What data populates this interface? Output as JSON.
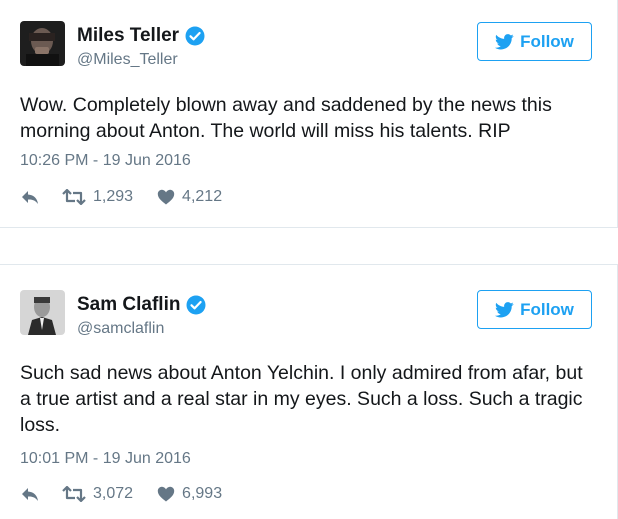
{
  "colors": {
    "accent": "#1da1f2",
    "text": "#14171a",
    "muted": "#657786",
    "divider": "#e1e8ed"
  },
  "tweets": [
    {
      "name": "Miles Teller",
      "handle": "@Miles_Teller",
      "follow_label": "Follow",
      "text": "Wow. Completely blown away and saddened by the news this morning about Anton. The world will miss his talents. RIP",
      "timestamp": "10:26 PM - 19 Jun 2016",
      "retweets": "1,293",
      "likes": "4,212",
      "icons": {
        "verified": "verified-badge-icon",
        "follow": "twitter-bird-icon",
        "reply": "reply-icon",
        "retweet": "retweet-icon",
        "like": "heart-icon"
      }
    },
    {
      "name": "Sam Claflin",
      "handle": "@samclaflin",
      "follow_label": "Follow",
      "text": "Such sad news about Anton Yelchin. I only admired from afar, but a true artist and a real star in my eyes. Such a loss. Such a tragic loss.",
      "timestamp": "10:01 PM - 19 Jun 2016",
      "retweets": "3,072",
      "likes": "6,993",
      "icons": {
        "verified": "verified-badge-icon",
        "follow": "twitter-bird-icon",
        "reply": "reply-icon",
        "retweet": "retweet-icon",
        "like": "heart-icon"
      }
    }
  ]
}
